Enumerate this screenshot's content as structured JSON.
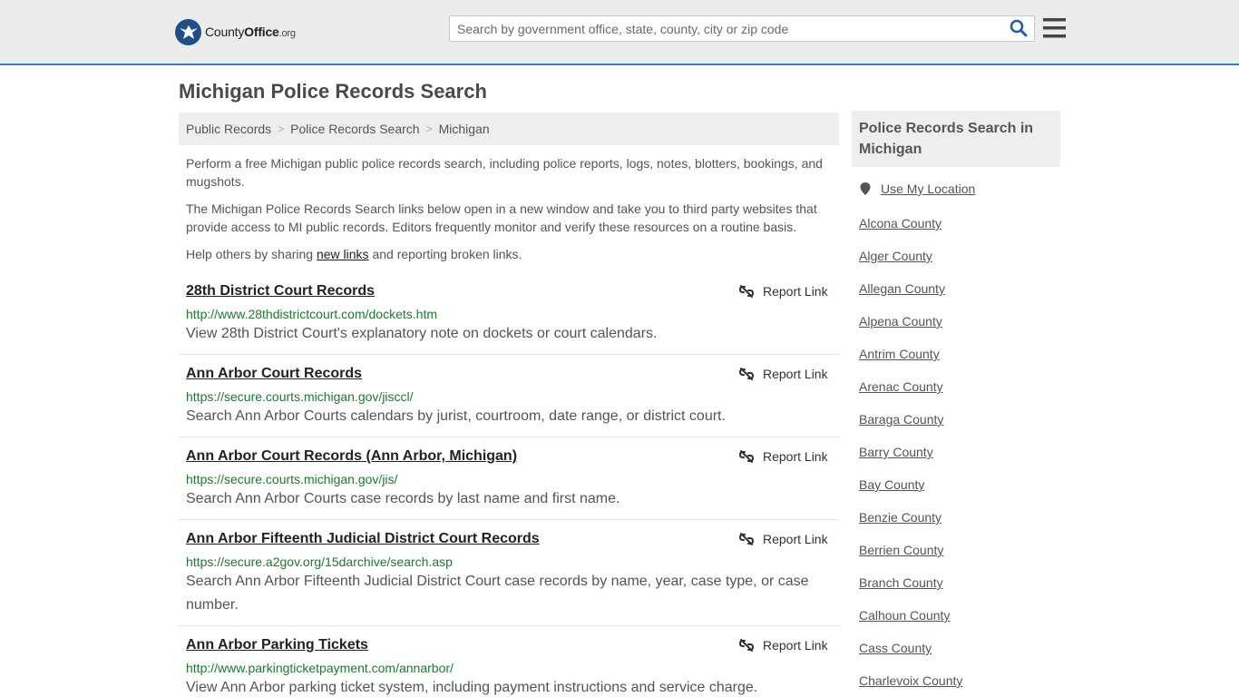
{
  "header": {
    "logo_name": "County",
    "logo_name2": "Office",
    "logo_tld": ".org",
    "search_placeholder": "Search by government office, state, county, city or zip code",
    "accent_color": "#3a7ab8"
  },
  "page": {
    "title": "Michigan Police Records Search",
    "breadcrumb": [
      "Public Records",
      "Police Records Search",
      "Michigan"
    ],
    "intro1": "Perform a free Michigan public police records search, including police reports, logs, notes, blotters, bookings, and mugshots.",
    "intro2": "The Michigan Police Records Search links below open in a new window and take you to third party websites that provide access to MI public records. Editors frequently monitor and verify these resources on a routine basis.",
    "intro3_prefix": "Help others by sharing ",
    "intro3_link": "new links",
    "intro3_suffix": " and reporting broken links."
  },
  "results": [
    {
      "title": "28th District Court Records",
      "url": "http://www.28thdistrictcourt.com/dockets.htm",
      "desc": "View 28th District Court's explanatory note on dockets or court calendars.",
      "report": "Report Link"
    },
    {
      "title": "Ann Arbor Court Records",
      "url": "https://secure.courts.michigan.gov/jisccl/",
      "desc": "Search Ann Arbor Courts calendars by jurist, courtroom, date range, or district court.",
      "report": "Report Link"
    },
    {
      "title": "Ann Arbor Court Records (Ann Arbor, Michigan)",
      "url": "https://secure.courts.michigan.gov/jis/",
      "desc": "Search Ann Arbor Courts case records by last name and first name.",
      "report": "Report Link"
    },
    {
      "title": "Ann Arbor Fifteenth Judicial District Court Records",
      "url": "https://secure.a2gov.org/15darchive/search.asp",
      "desc": "Search Ann Arbor Fifteenth Judicial District Court case records by name, year, case type, or case number.",
      "report": "Report Link"
    },
    {
      "title": "Ann Arbor Parking Tickets",
      "url": "http://www.parkingticketpayment.com/annarbor/",
      "desc": "View Ann Arbor parking ticket system, including payment instructions and service charge.",
      "report": "Report Link"
    }
  ],
  "sidebar": {
    "header": "Police Records Search in Michigan",
    "use_location": "Use My Location",
    "counties": [
      "Alcona County",
      "Alger County",
      "Allegan County",
      "Alpena County",
      "Antrim County",
      "Arenac County",
      "Baraga County",
      "Barry County",
      "Bay County",
      "Benzie County",
      "Berrien County",
      "Branch County",
      "Calhoun County",
      "Cass County",
      "Charlevoix County"
    ]
  }
}
